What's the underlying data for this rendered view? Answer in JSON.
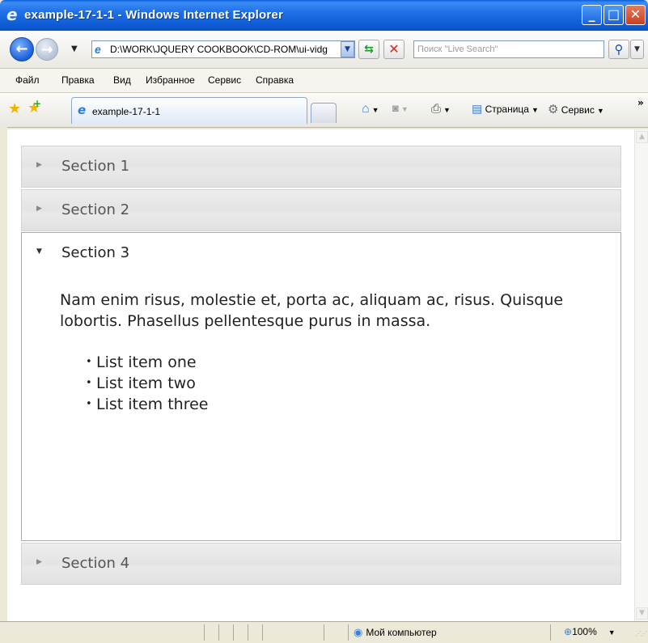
{
  "window": {
    "title": "example-17-1-1 - Windows Internet Explorer",
    "minimize": "_",
    "maximize": "□",
    "close": "✕",
    "ie_icon": "ie-logo-icon"
  },
  "address_bar": {
    "url": "D:\\WORK\\JQUERY COOKBOOK\\CD-ROM\\ui-vidg",
    "search_placeholder": "Поиск \"Live Search\""
  },
  "menu": {
    "items": [
      "Файл",
      "Правка",
      "Вид",
      "Избранное",
      "Сервис",
      "Справка"
    ]
  },
  "command_bar": {
    "tab_label": "example-17-1-1",
    "page_label": "Страница",
    "tools_label": "Сервис"
  },
  "accordion": {
    "sections": [
      {
        "label": "Section 1",
        "expanded": false
      },
      {
        "label": "Section 2",
        "expanded": false
      },
      {
        "label": "Section 3",
        "expanded": true
      },
      {
        "label": "Section 4",
        "expanded": false
      }
    ],
    "panel": {
      "paragraph": "Nam enim risus, molestie et, porta ac, aliquam ac, risus. Quisque lobortis. Phasellus pellentesque purus in massa.",
      "list": [
        "List item one",
        "List item two",
        "List item three"
      ]
    }
  },
  "status_bar": {
    "zone": "Мой компьютер",
    "zoom": "100%"
  }
}
